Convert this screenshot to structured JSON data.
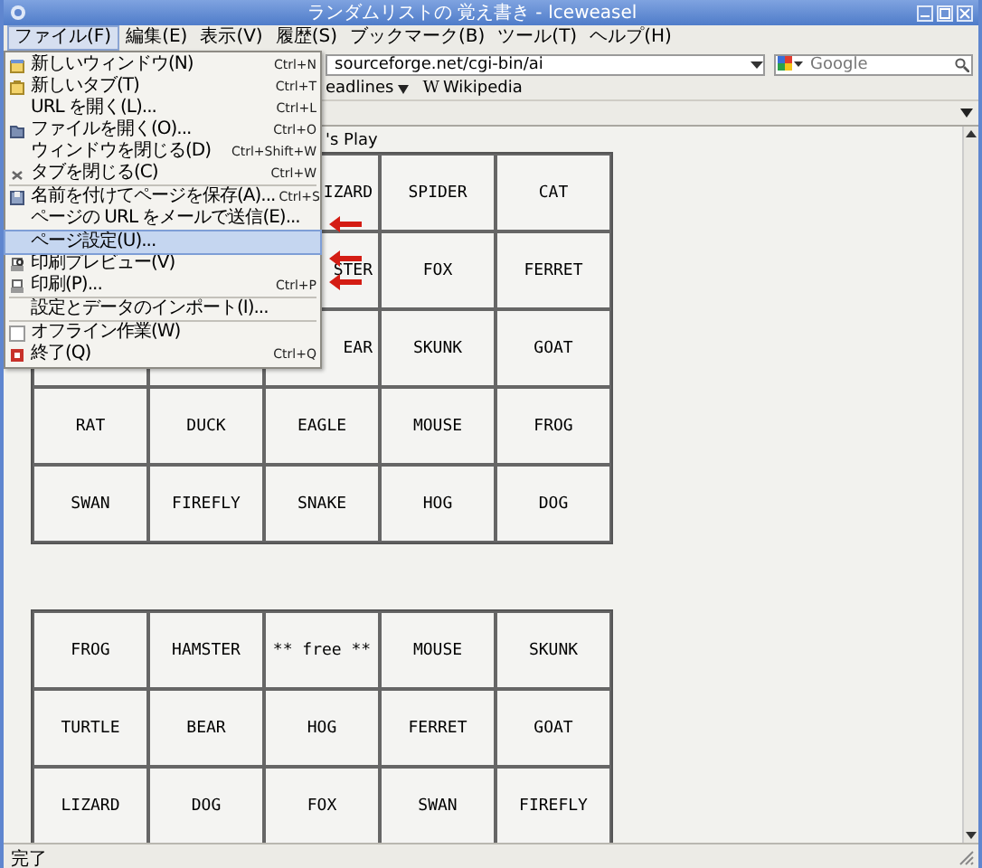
{
  "window": {
    "title": "ランダムリストの 覚え書き - Iceweasel"
  },
  "menubar": [
    {
      "label": "ファイル(F)",
      "selected": true
    },
    {
      "label": "編集(E)",
      "selected": false
    },
    {
      "label": "表示(V)",
      "selected": false
    },
    {
      "label": "履歴(S)",
      "selected": false
    },
    {
      "label": "ブックマーク(B)",
      "selected": false
    },
    {
      "label": "ツール(T)",
      "selected": false
    },
    {
      "label": "ヘルプ(H)",
      "selected": false
    }
  ],
  "toolbar": {
    "url": "sourceforge.net/cgi-bin/ai",
    "search": {
      "placeholder": "Google"
    }
  },
  "bookmarks": [
    {
      "label": "eadlines",
      "kind": "folder"
    },
    {
      "label": "Wikipedia",
      "kind": "site",
      "icon_text": "W"
    }
  ],
  "file_menu": [
    {
      "kind": "item",
      "label": "新しいウィンドウ(N)",
      "shortcut": "Ctrl+N",
      "selected": false
    },
    {
      "kind": "item",
      "label": "新しいタブ(T)",
      "shortcut": "Ctrl+T",
      "selected": false
    },
    {
      "kind": "item",
      "label": "URL を開く(L)...",
      "shortcut": "Ctrl+L",
      "selected": false
    },
    {
      "kind": "item",
      "label": "ファイルを開く(O)...",
      "shortcut": "Ctrl+O",
      "selected": false
    },
    {
      "kind": "item",
      "label": "ウィンドウを閉じる(D)",
      "shortcut": "Ctrl+Shift+W",
      "selected": false
    },
    {
      "kind": "item",
      "label": "タブを閉じる(C)",
      "shortcut": "Ctrl+W",
      "selected": false
    },
    {
      "kind": "separator"
    },
    {
      "kind": "item",
      "label": "名前を付けてページを保存(A)...",
      "shortcut": "Ctrl+S",
      "selected": false
    },
    {
      "kind": "item",
      "label": "ページの URL をメールで送信(E)...",
      "selected": false
    },
    {
      "kind": "separator"
    },
    {
      "kind": "item",
      "label": "ページ設定(U)...",
      "selected": true
    },
    {
      "kind": "item",
      "label": "印刷プレビュー(V)",
      "selected": false
    },
    {
      "kind": "item",
      "label": "印刷(P)...",
      "shortcut": "Ctrl+P",
      "selected": false
    },
    {
      "kind": "separator"
    },
    {
      "kind": "item",
      "label": "設定とデータのインポート(I)...",
      "selected": false
    },
    {
      "kind": "separator"
    },
    {
      "kind": "check",
      "label": "オフライン作業(W)",
      "checked": false,
      "selected": false
    },
    {
      "kind": "item",
      "label": "終了(Q)",
      "shortcut": "Ctrl+Q",
      "selected": false
    }
  ],
  "page": {
    "heading": "'s Play",
    "cards": [
      {
        "rows": [
          [
            "IZARD",
            "SPIDER",
            "CAT"
          ],
          [
            "STER",
            "FOX",
            "FERRET"
          ],
          [
            "EAR",
            "SKUNK",
            "GOAT"
          ],
          [
            "RAT",
            "DUCK",
            "EAGLE",
            "MOUSE",
            "FROG"
          ],
          [
            "SWAN",
            "FIREFLY",
            "SNAKE",
            "HOG",
            "DOG"
          ]
        ]
      },
      {
        "rows": [
          [
            "FROG",
            "HAMSTER",
            "** free **",
            "MOUSE",
            "SKUNK"
          ],
          [
            "TURTLE",
            "BEAR",
            "HOG",
            "FERRET",
            "GOAT"
          ],
          [
            "LIZARD",
            "DOG",
            "FOX",
            "SWAN",
            "FIREFLY"
          ]
        ]
      }
    ]
  },
  "status_bar": "完了"
}
